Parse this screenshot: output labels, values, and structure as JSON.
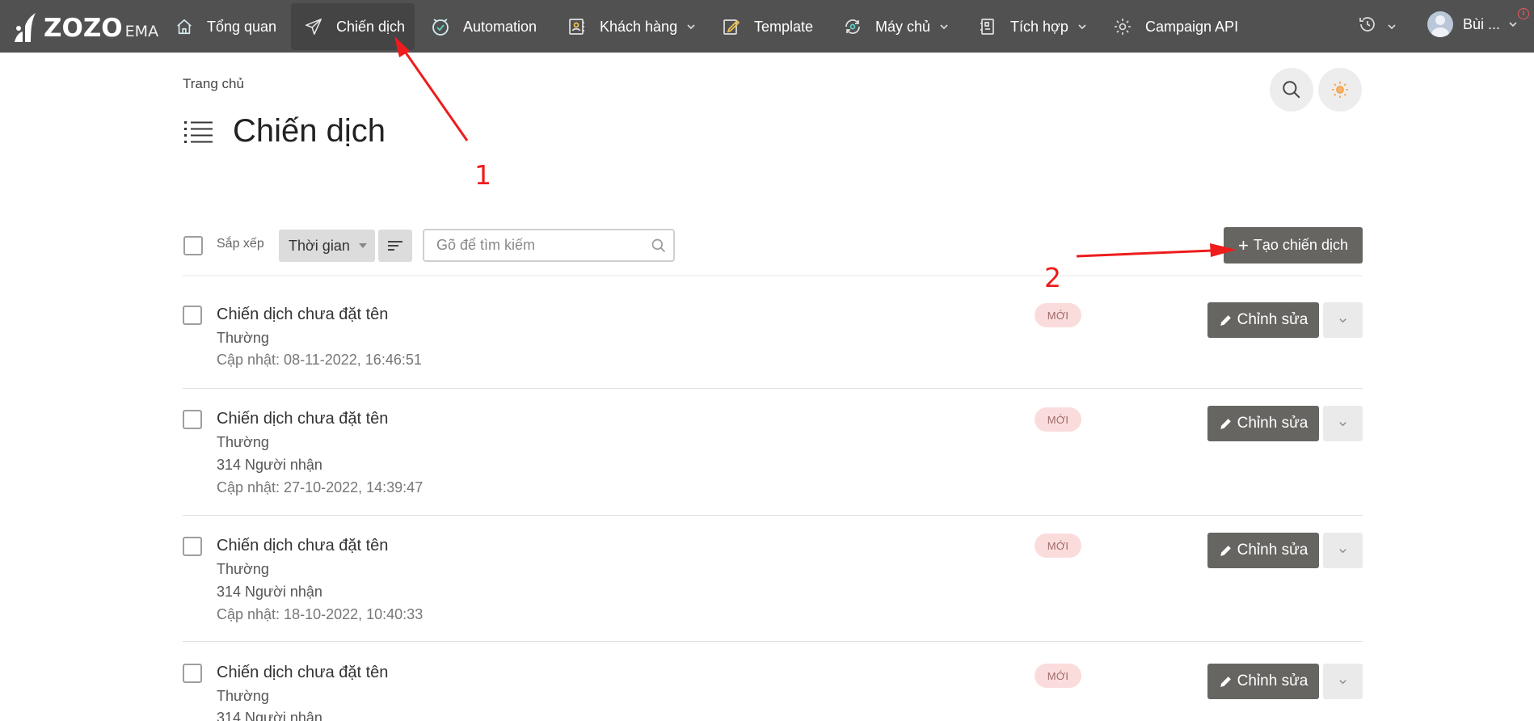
{
  "topbar": {
    "logo_brand": "ZOZO",
    "logo_sub": "EMA",
    "nav": [
      {
        "label": "Tổng quan",
        "icon": "home-icon"
      },
      {
        "label": "Chiến dịch",
        "icon": "paper-plane-icon",
        "active": true
      },
      {
        "label": "Automation",
        "icon": "shield-check-icon"
      },
      {
        "label": "Khách hàng",
        "icon": "contacts-icon",
        "has_dropdown": true
      },
      {
        "label": "Template",
        "icon": "edit-document-icon"
      },
      {
        "label": "Máy chủ",
        "icon": "server-sync-icon",
        "has_dropdown": true
      },
      {
        "label": "Tích hợp",
        "icon": "integration-icon",
        "has_dropdown": true
      },
      {
        "label": "Campaign API",
        "icon": "gear-api-icon"
      }
    ],
    "history_icon": "history-icon",
    "user_name": "Bùi ...",
    "info_glyph": "i"
  },
  "page": {
    "breadcrumb": "Trang chủ",
    "title": "Chiến dịch",
    "search_icon": "search-icon",
    "theme_icon": "sun-icon"
  },
  "annotations": {
    "label_1": "1",
    "label_2": "2",
    "color": "#ee1c1c"
  },
  "toolbar": {
    "sort_label": "Sắp xếp",
    "sort_value": "Thời gian",
    "search_placeholder": "Gõ để tìm kiếm",
    "search_value": "",
    "create_label": "Tạo chiến dịch",
    "create_icon": "+"
  },
  "campaigns": [
    {
      "name": "Chiến dịch chưa đặt tên",
      "type": "Thường",
      "recipients": "",
      "updated": "Cập nhật: 08-11-2022, 16:46:51",
      "badge": "MỚI",
      "edit_label": "Chỉnh sửa"
    },
    {
      "name": "Chiến dịch chưa đặt tên",
      "type": "Thường",
      "recipients": "314 Người nhận",
      "updated": "Cập nhật: 27-10-2022, 14:39:47",
      "badge": "MỚI",
      "edit_label": "Chỉnh sửa"
    },
    {
      "name": "Chiến dịch chưa đặt tên",
      "type": "Thường",
      "recipients": "314 Người nhận",
      "updated": "Cập nhật: 18-10-2022, 10:40:33",
      "badge": "MỚI",
      "edit_label": "Chỉnh sửa"
    },
    {
      "name": "Chiến dịch chưa đặt tên",
      "type": "Thường",
      "recipients": "314 Người nhận",
      "updated": "",
      "badge": "MỚI",
      "edit_label": "Chỉnh sửa"
    }
  ],
  "colors": {
    "topbar": "#515151",
    "button_dark": "#666561",
    "badge_bg": "#fbdcdc"
  }
}
